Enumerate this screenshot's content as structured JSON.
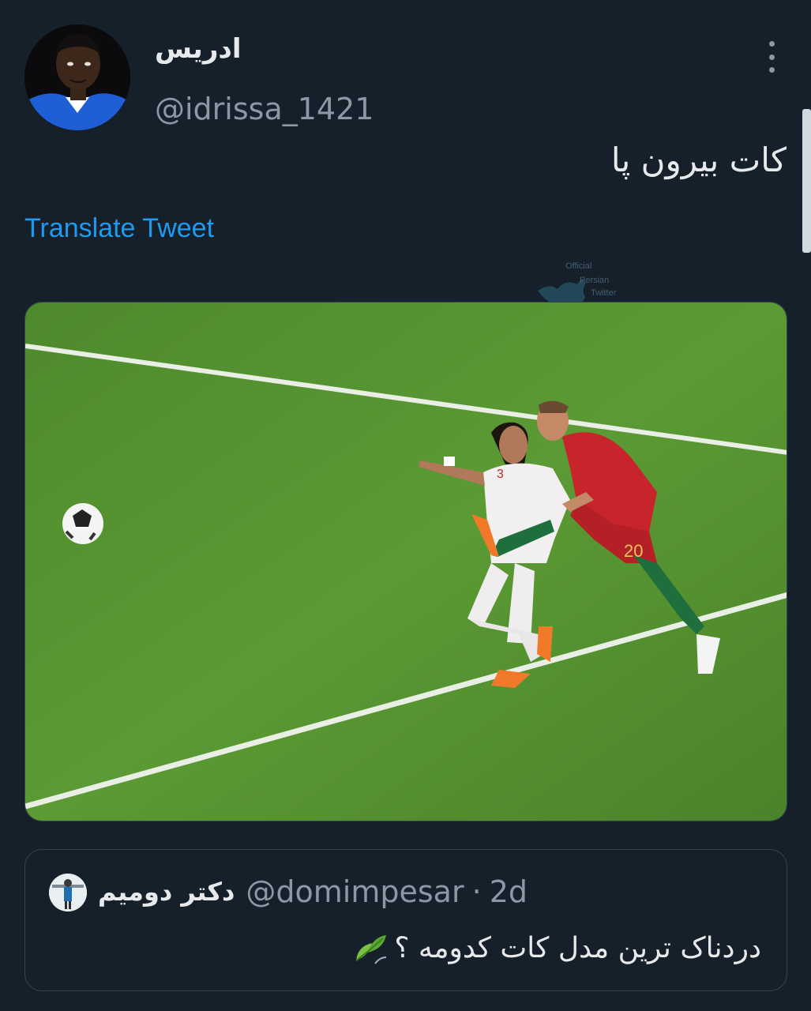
{
  "author": {
    "display_name": "ادریس",
    "handle": "@idrissa_1421"
  },
  "tweet": {
    "text": "کات بیرون پا",
    "translate_label": "Translate Tweet"
  },
  "watermark": {
    "lines": [
      "Official",
      "Persian",
      "Twitter"
    ]
  },
  "quoted_tweet": {
    "display_name": "دکتر دومیم",
    "handle": "@domimpesar",
    "separator": "·",
    "time": "2d",
    "text": "دردناک ترین مدل کات کدومه ؟",
    "emoji_icon": "leaf-fluttering-icon"
  },
  "icons": {
    "more": "more-vertical-icon"
  },
  "colors": {
    "background": "#15202b",
    "link": "#1d9bf0",
    "text_primary": "#e7e9ea",
    "text_secondary": "#8b98a5",
    "border": "#38444d"
  }
}
